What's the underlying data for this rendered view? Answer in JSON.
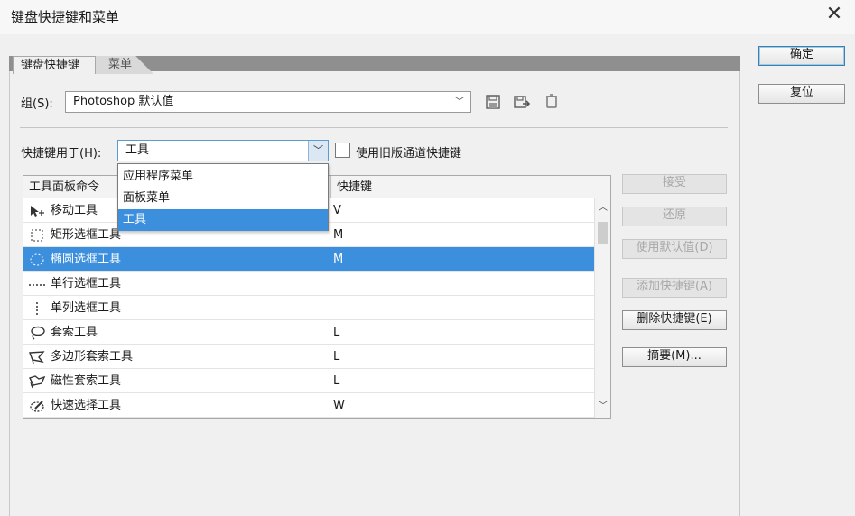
{
  "dialog": {
    "title": "键盘快捷键和菜单",
    "close_icon": "close-icon"
  },
  "tabs": [
    {
      "label": "键盘快捷键",
      "active": true
    },
    {
      "label": "菜单",
      "active": false
    }
  ],
  "group": {
    "label": "组(S):",
    "value": "Photoshop 默认值"
  },
  "shortcuts_for": {
    "label": "快捷键用于(H):",
    "value": "工具",
    "options": [
      "应用程序菜单",
      "面板菜单",
      "工具"
    ],
    "selected_index": 2
  },
  "legacy_channel": {
    "label": "使用旧版通道快捷键",
    "checked": false
  },
  "table": {
    "columns": [
      "工具面板命令",
      "快捷键"
    ],
    "rows": [
      {
        "icon": "move-tool-icon",
        "name": "移动工具",
        "key": "V"
      },
      {
        "icon": "rect-marquee-icon",
        "name": "矩形选框工具",
        "key": "M"
      },
      {
        "icon": "ellipse-marquee-icon",
        "name": "椭圆选框工具",
        "key": "M",
        "selected": true
      },
      {
        "icon": "single-row-marquee-icon",
        "name": "单行选框工具",
        "key": ""
      },
      {
        "icon": "single-column-marquee-icon",
        "name": "单列选框工具",
        "key": ""
      },
      {
        "icon": "lasso-icon",
        "name": "套索工具",
        "key": "L"
      },
      {
        "icon": "polygon-lasso-icon",
        "name": "多边形套索工具",
        "key": "L"
      },
      {
        "icon": "magnetic-lasso-icon",
        "name": "磁性套索工具",
        "key": "L"
      },
      {
        "icon": "quick-select-icon",
        "name": "快速选择工具",
        "key": "W"
      }
    ]
  },
  "side_buttons": {
    "accept": "接受",
    "undo": "还原",
    "use_default": "使用默认值(D)",
    "add_shortcut": "添加快捷键(A)",
    "delete_shortcut": "删除快捷键(E)",
    "summary": "摘要(M)..."
  },
  "dialog_buttons": {
    "ok": "确定",
    "reset": "复位"
  },
  "colors": {
    "selection": "#3c8fdc",
    "tab_strip": "#8f8f8f"
  }
}
